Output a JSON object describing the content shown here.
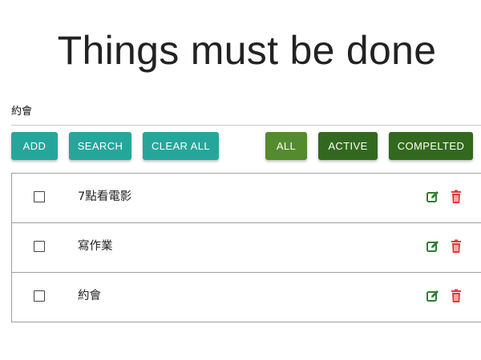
{
  "header": {
    "title": "Things must be done"
  },
  "input": {
    "value": "約會"
  },
  "buttons": {
    "add": "ADD",
    "search": "SEARCH",
    "clear_all": "CLEAR ALL",
    "all": "ALL",
    "active": "ACTIVE",
    "completed": "COMPELTED"
  },
  "todos": [
    {
      "label": "7點看電影",
      "checked": false
    },
    {
      "label": "寫作業",
      "checked": false
    },
    {
      "label": "約會",
      "checked": false
    }
  ],
  "icons": {
    "edit": "edit-icon",
    "delete": "trash-icon"
  },
  "colors": {
    "teal_button": "#26a69a",
    "all_filter": "#558b2f",
    "dark_green_filter": "#33691e",
    "edit_icon": "#2e7d32",
    "delete_icon": "#e53935"
  }
}
